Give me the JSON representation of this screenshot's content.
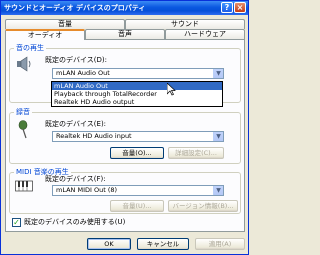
{
  "window": {
    "title": "サウンドとオーディオ デバイスのプロパティ",
    "help_label": "?",
    "close_label": "×"
  },
  "tabs_back": [
    "音量",
    "サウンド"
  ],
  "tabs_front": [
    "オーディオ",
    "音声",
    "ハードウェア"
  ],
  "playback": {
    "group_title": "音の再生",
    "device_label": "既定のデバイス(D):",
    "selected": "mLAN Audio Out",
    "dropdown_items": [
      "mLAN Audio Out",
      "Playback through TotalRecorder",
      "Realtek HD Audio output"
    ],
    "selected_index": 0
  },
  "recording": {
    "group_title": "録音",
    "device_label": "既定のデバイス(E):",
    "selected": "Realtek HD Audio input",
    "volume_button": "音量(O)...",
    "advanced_button": "詳細設定(C)..."
  },
  "midi": {
    "group_title": "MIDI 音楽の再生",
    "device_label": "既定のデバイス(F):",
    "selected": "mLAN MIDI Out (8)",
    "volume_button": "音量(U)...",
    "version_button": "バージョン情報(B)..."
  },
  "default_only_checkbox": {
    "label": "既定のデバイスのみ使用する(U)",
    "checked": true
  },
  "footer": {
    "ok": "OK",
    "cancel": "キャンセル",
    "apply": "適用(A)"
  }
}
